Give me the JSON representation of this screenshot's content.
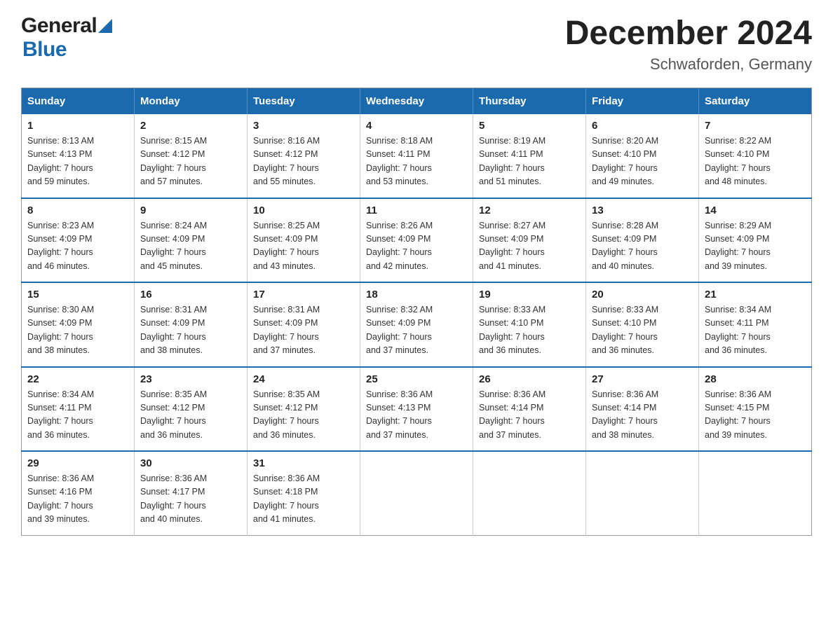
{
  "logo": {
    "general": "General",
    "blue": "Blue"
  },
  "title": {
    "month": "December 2024",
    "location": "Schwaforden, Germany"
  },
  "calendar": {
    "headers": [
      "Sunday",
      "Monday",
      "Tuesday",
      "Wednesday",
      "Thursday",
      "Friday",
      "Saturday"
    ],
    "weeks": [
      [
        {
          "day": "1",
          "sunrise": "8:13 AM",
          "sunset": "4:13 PM",
          "daylight": "7 hours and 59 minutes."
        },
        {
          "day": "2",
          "sunrise": "8:15 AM",
          "sunset": "4:12 PM",
          "daylight": "7 hours and 57 minutes."
        },
        {
          "day": "3",
          "sunrise": "8:16 AM",
          "sunset": "4:12 PM",
          "daylight": "7 hours and 55 minutes."
        },
        {
          "day": "4",
          "sunrise": "8:18 AM",
          "sunset": "4:11 PM",
          "daylight": "7 hours and 53 minutes."
        },
        {
          "day": "5",
          "sunrise": "8:19 AM",
          "sunset": "4:11 PM",
          "daylight": "7 hours and 51 minutes."
        },
        {
          "day": "6",
          "sunrise": "8:20 AM",
          "sunset": "4:10 PM",
          "daylight": "7 hours and 49 minutes."
        },
        {
          "day": "7",
          "sunrise": "8:22 AM",
          "sunset": "4:10 PM",
          "daylight": "7 hours and 48 minutes."
        }
      ],
      [
        {
          "day": "8",
          "sunrise": "8:23 AM",
          "sunset": "4:09 PM",
          "daylight": "7 hours and 46 minutes."
        },
        {
          "day": "9",
          "sunrise": "8:24 AM",
          "sunset": "4:09 PM",
          "daylight": "7 hours and 45 minutes."
        },
        {
          "day": "10",
          "sunrise": "8:25 AM",
          "sunset": "4:09 PM",
          "daylight": "7 hours and 43 minutes."
        },
        {
          "day": "11",
          "sunrise": "8:26 AM",
          "sunset": "4:09 PM",
          "daylight": "7 hours and 42 minutes."
        },
        {
          "day": "12",
          "sunrise": "8:27 AM",
          "sunset": "4:09 PM",
          "daylight": "7 hours and 41 minutes."
        },
        {
          "day": "13",
          "sunrise": "8:28 AM",
          "sunset": "4:09 PM",
          "daylight": "7 hours and 40 minutes."
        },
        {
          "day": "14",
          "sunrise": "8:29 AM",
          "sunset": "4:09 PM",
          "daylight": "7 hours and 39 minutes."
        }
      ],
      [
        {
          "day": "15",
          "sunrise": "8:30 AM",
          "sunset": "4:09 PM",
          "daylight": "7 hours and 38 minutes."
        },
        {
          "day": "16",
          "sunrise": "8:31 AM",
          "sunset": "4:09 PM",
          "daylight": "7 hours and 38 minutes."
        },
        {
          "day": "17",
          "sunrise": "8:31 AM",
          "sunset": "4:09 PM",
          "daylight": "7 hours and 37 minutes."
        },
        {
          "day": "18",
          "sunrise": "8:32 AM",
          "sunset": "4:09 PM",
          "daylight": "7 hours and 37 minutes."
        },
        {
          "day": "19",
          "sunrise": "8:33 AM",
          "sunset": "4:10 PM",
          "daylight": "7 hours and 36 minutes."
        },
        {
          "day": "20",
          "sunrise": "8:33 AM",
          "sunset": "4:10 PM",
          "daylight": "7 hours and 36 minutes."
        },
        {
          "day": "21",
          "sunrise": "8:34 AM",
          "sunset": "4:11 PM",
          "daylight": "7 hours and 36 minutes."
        }
      ],
      [
        {
          "day": "22",
          "sunrise": "8:34 AM",
          "sunset": "4:11 PM",
          "daylight": "7 hours and 36 minutes."
        },
        {
          "day": "23",
          "sunrise": "8:35 AM",
          "sunset": "4:12 PM",
          "daylight": "7 hours and 36 minutes."
        },
        {
          "day": "24",
          "sunrise": "8:35 AM",
          "sunset": "4:12 PM",
          "daylight": "7 hours and 36 minutes."
        },
        {
          "day": "25",
          "sunrise": "8:36 AM",
          "sunset": "4:13 PM",
          "daylight": "7 hours and 37 minutes."
        },
        {
          "day": "26",
          "sunrise": "8:36 AM",
          "sunset": "4:14 PM",
          "daylight": "7 hours and 37 minutes."
        },
        {
          "day": "27",
          "sunrise": "8:36 AM",
          "sunset": "4:14 PM",
          "daylight": "7 hours and 38 minutes."
        },
        {
          "day": "28",
          "sunrise": "8:36 AM",
          "sunset": "4:15 PM",
          "daylight": "7 hours and 39 minutes."
        }
      ],
      [
        {
          "day": "29",
          "sunrise": "8:36 AM",
          "sunset": "4:16 PM",
          "daylight": "7 hours and 39 minutes."
        },
        {
          "day": "30",
          "sunrise": "8:36 AM",
          "sunset": "4:17 PM",
          "daylight": "7 hours and 40 minutes."
        },
        {
          "day": "31",
          "sunrise": "8:36 AM",
          "sunset": "4:18 PM",
          "daylight": "7 hours and 41 minutes."
        },
        null,
        null,
        null,
        null
      ]
    ],
    "labels": {
      "sunrise": "Sunrise:",
      "sunset": "Sunset:",
      "daylight": "Daylight:"
    }
  }
}
